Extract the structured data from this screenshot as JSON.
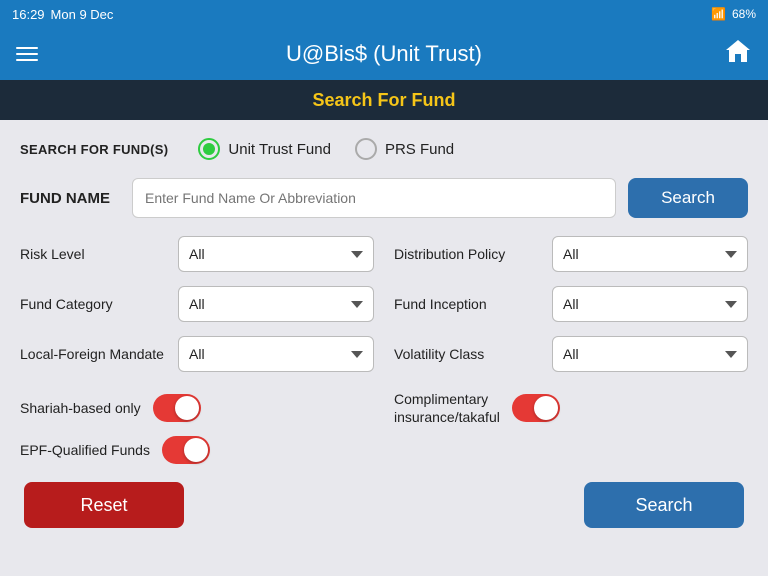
{
  "statusBar": {
    "time": "16:29",
    "date": "Mon 9 Dec",
    "wifi": "wifi",
    "battery": "68%"
  },
  "header": {
    "title": "U@Bis$ (Unit Trust)",
    "hamburger": "menu",
    "home": "home"
  },
  "subHeader": {
    "title": "Search For Fund"
  },
  "fundTypeSection": {
    "label": "SEARCH FOR FUND(S)",
    "options": [
      {
        "id": "unit-trust",
        "label": "Unit Trust Fund",
        "selected": true
      },
      {
        "id": "prs",
        "label": "PRS Fund",
        "selected": false
      }
    ]
  },
  "fundNameSection": {
    "label": "FUND NAME",
    "placeholder": "Enter Fund Name Or Abbreviation",
    "value": "",
    "searchLabel": "Search"
  },
  "filters": [
    {
      "id": "risk-level",
      "label": "Risk Level",
      "value": "All",
      "options": [
        "All"
      ]
    },
    {
      "id": "distribution-policy",
      "label": "Distribution Policy",
      "value": "All",
      "options": [
        "All"
      ]
    },
    {
      "id": "fund-category",
      "label": "Fund Category",
      "value": "All",
      "options": [
        "All"
      ]
    },
    {
      "id": "fund-inception",
      "label": "Fund Inception",
      "value": "All",
      "options": [
        "All"
      ]
    },
    {
      "id": "local-foreign-mandate",
      "label": "Local-Foreign Mandate",
      "value": "All",
      "options": [
        "All"
      ]
    },
    {
      "id": "volatility-class",
      "label": "Volatility Class",
      "value": "All",
      "options": [
        "All"
      ]
    }
  ],
  "toggles": [
    {
      "id": "shariah-based",
      "label": "Shariah-based only",
      "enabled": true
    },
    {
      "id": "complimentary-insurance",
      "label": "Complimentary\ninsurance/takaful",
      "enabled": true
    },
    {
      "id": "epf-qualified",
      "label": "EPF-Qualified Funds",
      "enabled": true
    }
  ],
  "buttons": {
    "reset": "Reset",
    "search": "Search"
  }
}
